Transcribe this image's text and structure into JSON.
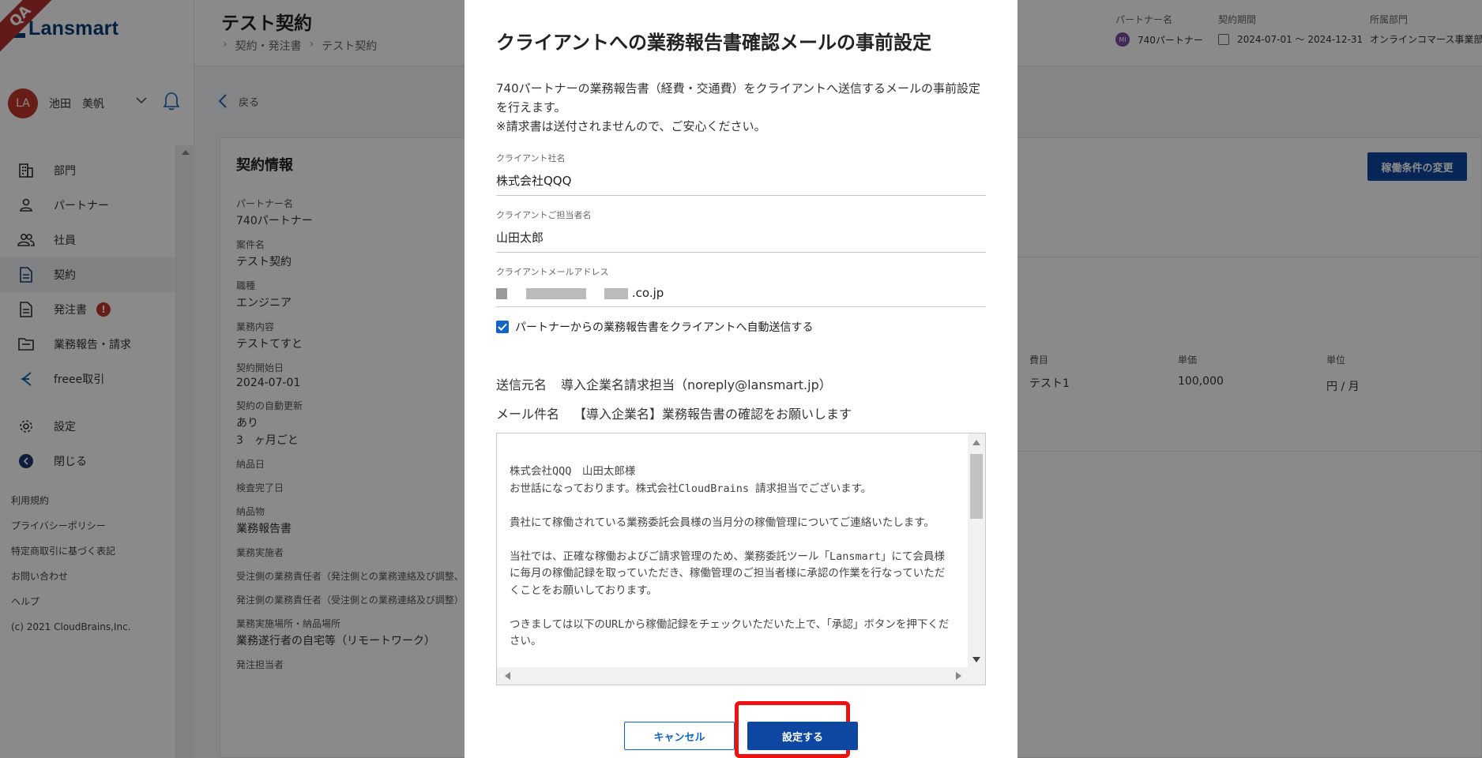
{
  "app": {
    "logo_text": "Lansmart",
    "qa_badge": "QA"
  },
  "sidebar": {
    "user": {
      "initials": "LA",
      "name": "池田　美帆"
    },
    "items": [
      {
        "label": "部門",
        "icon": "building-icon"
      },
      {
        "label": "パートナー",
        "icon": "person-icon"
      },
      {
        "label": "社員",
        "icon": "people-icon"
      },
      {
        "label": "契約",
        "icon": "document-icon"
      },
      {
        "label": "発注書",
        "icon": "document-icon",
        "badge": "!"
      },
      {
        "label": "業務報告・請求",
        "icon": "folder-icon"
      },
      {
        "label": "freee取引",
        "icon": "freee-icon"
      },
      {
        "label": "設定",
        "icon": "gear-icon"
      },
      {
        "label": "閉じる",
        "icon": "collapse-icon"
      }
    ],
    "footer": [
      "利用規約",
      "プライバシーポリシー",
      "特定商取引に基づく表記",
      "お問い合わせ",
      "ヘルプ",
      "(c) 2021 CloudBrains,Inc."
    ]
  },
  "header": {
    "title": "テスト契約",
    "breadcrumb": [
      "契約・発注書",
      "テスト契約"
    ],
    "meta": {
      "partner_label": "パートナー名",
      "partner_value": "740パートナー",
      "partner_avatar": "MI",
      "period_label": "契約期間",
      "period_value": "2024-07-01 ～ 2024-12-31",
      "dept_label": "所属部門",
      "dept_value": "オンラインコマース事業部"
    }
  },
  "main": {
    "back_label": "戻る",
    "card_title": "契約情報",
    "change_button": "稼働条件の変更",
    "fields": [
      {
        "label": "パートナー名",
        "value": "740パートナー"
      },
      {
        "label": "案件名",
        "value": "テスト契約"
      },
      {
        "label": "職種",
        "value": "エンジニア"
      },
      {
        "label": "業務内容",
        "value": "テストてすと"
      },
      {
        "label": "契約開始日",
        "value": "2024-07-01"
      },
      {
        "label": "契約の自動更新",
        "value": "あり"
      }
    ],
    "renewal_period": "3　ヶ月ごと",
    "fields2": [
      {
        "label": "納品日",
        "value": ""
      },
      {
        "label": "検査完了日",
        "value": ""
      },
      {
        "label": "納品物",
        "value": "業務報告書"
      },
      {
        "label": "業務実施者",
        "value": ""
      },
      {
        "label": "受注側の業務責任者（発注側との業務連絡及び調整、",
        "value": ""
      },
      {
        "label": "発注側の業務責任者（受注側との業務連絡及び調整）",
        "value": ""
      },
      {
        "label": "業務実施場所・納品場所",
        "value": "業務遂行者の自宅等（リモートワーク）"
      },
      {
        "label": "発注担当者",
        "value": ""
      }
    ],
    "table": {
      "headers": [
        "費目",
        "単価",
        "単位"
      ],
      "row": [
        "テスト1",
        "100,000",
        "円 / 月"
      ]
    }
  },
  "modal": {
    "title": "クライアントへの業務報告書確認メールの事前設定",
    "description_1": "740パートナーの業務報告書（経費・交通費）をクライアントへ送信するメールの事前設定を行えます。",
    "description_2": "※請求書は送付されませんので、ご安心ください。",
    "client_company_label": "クライアント社名",
    "client_company_value": "株式会社QQQ",
    "client_contact_label": "クライアントご担当者名",
    "client_contact_value": "山田太郎",
    "client_email_label": "クライアントメールアドレス",
    "client_email_suffix": ".co.jp",
    "auto_send_label": "パートナーからの業務報告書をクライアントへ自動送信する",
    "auto_send_checked": true,
    "sender_label": "送信元名",
    "sender_value": "導入企業名請求担当（noreply@lansmart.jp）",
    "subject_label": "メール件名",
    "subject_value": "【導入企業名】業務報告書の確認をお願いします",
    "body": "株式会社QQQ　山田太郎様\nお世話になっております。株式会社CloudBrains 請求担当でございます。\n\n貴社にて稼働されている業務委託会員様の当月分の稼働管理についてご連絡いたします。\n\n当社では、正確な稼働およびご請求管理のため、業務委託ツール「Lansmart」にて会員様に毎月の稼働記録を取っていただき、稼働管理のご担当者様に承認の作業を行なっていただくことをお願いしております。\n\nつきましては以下のURLから稼働記録をチェックいただいた上で、「承認」ボタンを押下ください。",
    "cancel_label": "キャンセル",
    "confirm_label": "設定する"
  },
  "colors": {
    "brand": "#0c3c78",
    "primary_button": "#0d47a1",
    "highlight": "#ee1111",
    "badge": "#c0392b"
  }
}
